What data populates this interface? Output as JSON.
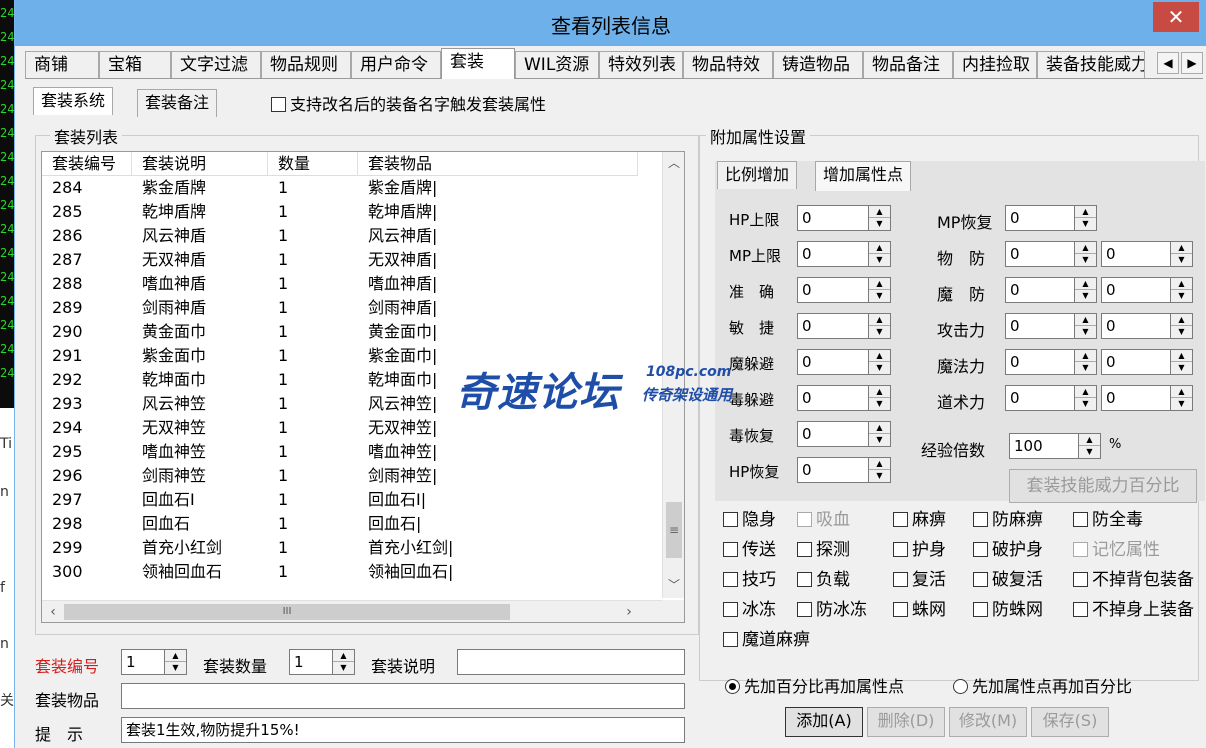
{
  "window": {
    "title": "查看列表信息",
    "close_icon": "✕"
  },
  "side_strip": {
    "digits": [
      "24",
      "24",
      "24",
      "24",
      "24",
      "24",
      "24",
      "24",
      "24",
      "24",
      "24",
      "24",
      "24",
      "24",
      "24",
      "24"
    ],
    "letters": [
      "Ti",
      "n",
      "",
      "f",
      "n",
      "关"
    ]
  },
  "tabs": [
    "商铺",
    "宝箱",
    "文字过滤",
    "物品规则",
    "用户命令",
    "套装",
    "WIL资源",
    "特效列表",
    "物品特效",
    "铸造物品",
    "物品备注",
    "内挂捡取",
    "装备技能威力"
  ],
  "active_tab": "套装",
  "subtabs": [
    "套装系统",
    "套装备注"
  ],
  "support_rename_label": "支持改名后的装备名字触发套装属性",
  "suit_list": {
    "group_title": "套装列表",
    "columns": [
      "套装编号",
      "套装说明",
      "数量",
      "套装物品"
    ],
    "rows": [
      [
        "284",
        "紫金盾牌",
        "1",
        "紫金盾牌|"
      ],
      [
        "285",
        "乾坤盾牌",
        "1",
        "乾坤盾牌|"
      ],
      [
        "286",
        "风云神盾",
        "1",
        "风云神盾|"
      ],
      [
        "287",
        "无双神盾",
        "1",
        "无双神盾|"
      ],
      [
        "288",
        "嗜血神盾",
        "1",
        "嗜血神盾|"
      ],
      [
        "289",
        "剑雨神盾",
        "1",
        "剑雨神盾|"
      ],
      [
        "290",
        "黄金面巾",
        "1",
        "黄金面巾|"
      ],
      [
        "291",
        "紫金面巾",
        "1",
        "紫金面巾|"
      ],
      [
        "292",
        "乾坤面巾",
        "1",
        "乾坤面巾|"
      ],
      [
        "293",
        "风云神笠",
        "1",
        "风云神笠|"
      ],
      [
        "294",
        "无双神笠",
        "1",
        "无双神笠|"
      ],
      [
        "295",
        "嗜血神笠",
        "1",
        "嗜血神笠|"
      ],
      [
        "296",
        "剑雨神笠",
        "1",
        "剑雨神笠|"
      ],
      [
        "297",
        "回血石I",
        "1",
        "回血石I|"
      ],
      [
        "298",
        "回血石",
        "1",
        "回血石|"
      ],
      [
        "299",
        "首充小红剑",
        "1",
        "首充小红剑|"
      ],
      [
        "300",
        "领袖回血石",
        "1",
        "领袖回血石|"
      ]
    ]
  },
  "form": {
    "suit_no_label": "套装编号",
    "suit_no_value": "1",
    "suit_count_label": "套装数量",
    "suit_count_value": "1",
    "suit_desc_label": "套装说明",
    "suit_desc_value": "",
    "suit_items_label": "套装物品",
    "suit_items_value": "",
    "hint_label": "提　示",
    "hint_value": "套装1生效,物防提升15%!"
  },
  "attr": {
    "group_title": "附加属性设置",
    "mode_tabs": [
      "比例增加",
      "增加属性点"
    ],
    "left_fields": [
      {
        "label": "HP上限",
        "value": "0"
      },
      {
        "label": "MP上限",
        "value": "0"
      },
      {
        "label": "准　确",
        "value": "0"
      },
      {
        "label": "敏　捷",
        "value": "0"
      },
      {
        "label": "魔躲避",
        "value": "0"
      },
      {
        "label": "毒躲避",
        "value": "0"
      },
      {
        "label": "毒恢复",
        "value": "0"
      },
      {
        "label": "HP恢复",
        "value": "0"
      }
    ],
    "right_fields": [
      {
        "label": "MP恢复",
        "value": "0",
        "value2": null
      },
      {
        "label": "物　防",
        "value": "0",
        "value2": "0"
      },
      {
        "label": "魔　防",
        "value": "0",
        "value2": "0"
      },
      {
        "label": "攻击力",
        "value": "0",
        "value2": "0"
      },
      {
        "label": "魔法力",
        "value": "0",
        "value2": "0"
      },
      {
        "label": "道术力",
        "value": "0",
        "value2": "0"
      }
    ],
    "exp_label": "经验倍数",
    "exp_value": "100",
    "exp_unit": "%",
    "skill_button": "套装技能威力百分比"
  },
  "flags": [
    [
      {
        "label": "隐身",
        "enabled": true
      },
      {
        "label": "吸血",
        "enabled": false
      },
      {
        "label": "麻痹",
        "enabled": true
      },
      {
        "label": "防麻痹",
        "enabled": true
      },
      {
        "label": "防全毒",
        "enabled": true
      }
    ],
    [
      {
        "label": "传送",
        "enabled": true
      },
      {
        "label": "探测",
        "enabled": true
      },
      {
        "label": "护身",
        "enabled": true
      },
      {
        "label": "破护身",
        "enabled": true
      },
      {
        "label": "记忆属性",
        "enabled": false
      }
    ],
    [
      {
        "label": "技巧",
        "enabled": true
      },
      {
        "label": "负载",
        "enabled": true
      },
      {
        "label": "复活",
        "enabled": true
      },
      {
        "label": "破复活",
        "enabled": true
      },
      {
        "label": "不掉背包装备",
        "enabled": true
      }
    ],
    [
      {
        "label": "冰冻",
        "enabled": true
      },
      {
        "label": "防冰冻",
        "enabled": true
      },
      {
        "label": "蛛网",
        "enabled": true
      },
      {
        "label": "防蛛网",
        "enabled": true
      },
      {
        "label": "不掉身上装备",
        "enabled": true
      }
    ],
    [
      {
        "label": "魔道麻痹",
        "enabled": true
      }
    ]
  ],
  "order_options": [
    {
      "label": "先加百分比再加属性点",
      "selected": true
    },
    {
      "label": "先加属性点再加百分比",
      "selected": false
    }
  ],
  "buttons": {
    "add": "添加(A)",
    "delete": "删除(D)",
    "modify": "修改(M)",
    "save": "保存(S)"
  },
  "watermark": {
    "main": "奇速论坛",
    "url": "108pc.com",
    "sub": "传奇架设通用"
  },
  "colors": {
    "titlebar": "#6eb0ea",
    "close": "#c74a43",
    "required_label": "#d41e1e",
    "watermark": "#1f4ea8"
  }
}
